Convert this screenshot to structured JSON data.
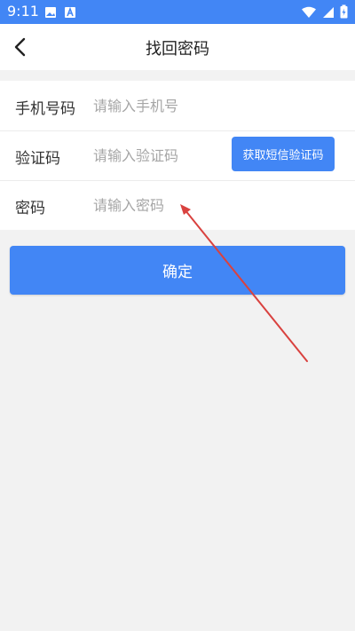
{
  "status_bar": {
    "time": "9:11",
    "icons_left": [
      "image-icon",
      "a-icon"
    ],
    "icons_right": [
      "wifi-icon",
      "signal-icon",
      "battery-icon"
    ]
  },
  "header": {
    "title": "找回密码",
    "back_icon": "chevron-left-icon"
  },
  "form": {
    "phone": {
      "label": "手机号码",
      "placeholder": "请输入手机号",
      "value": ""
    },
    "code": {
      "label": "验证码",
      "placeholder": "请输入验证码",
      "value": "",
      "button_label": "获取短信验证码"
    },
    "password": {
      "label": "密码",
      "placeholder": "请输入密码",
      "value": ""
    }
  },
  "confirm_label": "确定",
  "colors": {
    "primary": "#4286f5",
    "background": "#f2f2f2",
    "annotation_arrow": "#d9423f"
  }
}
